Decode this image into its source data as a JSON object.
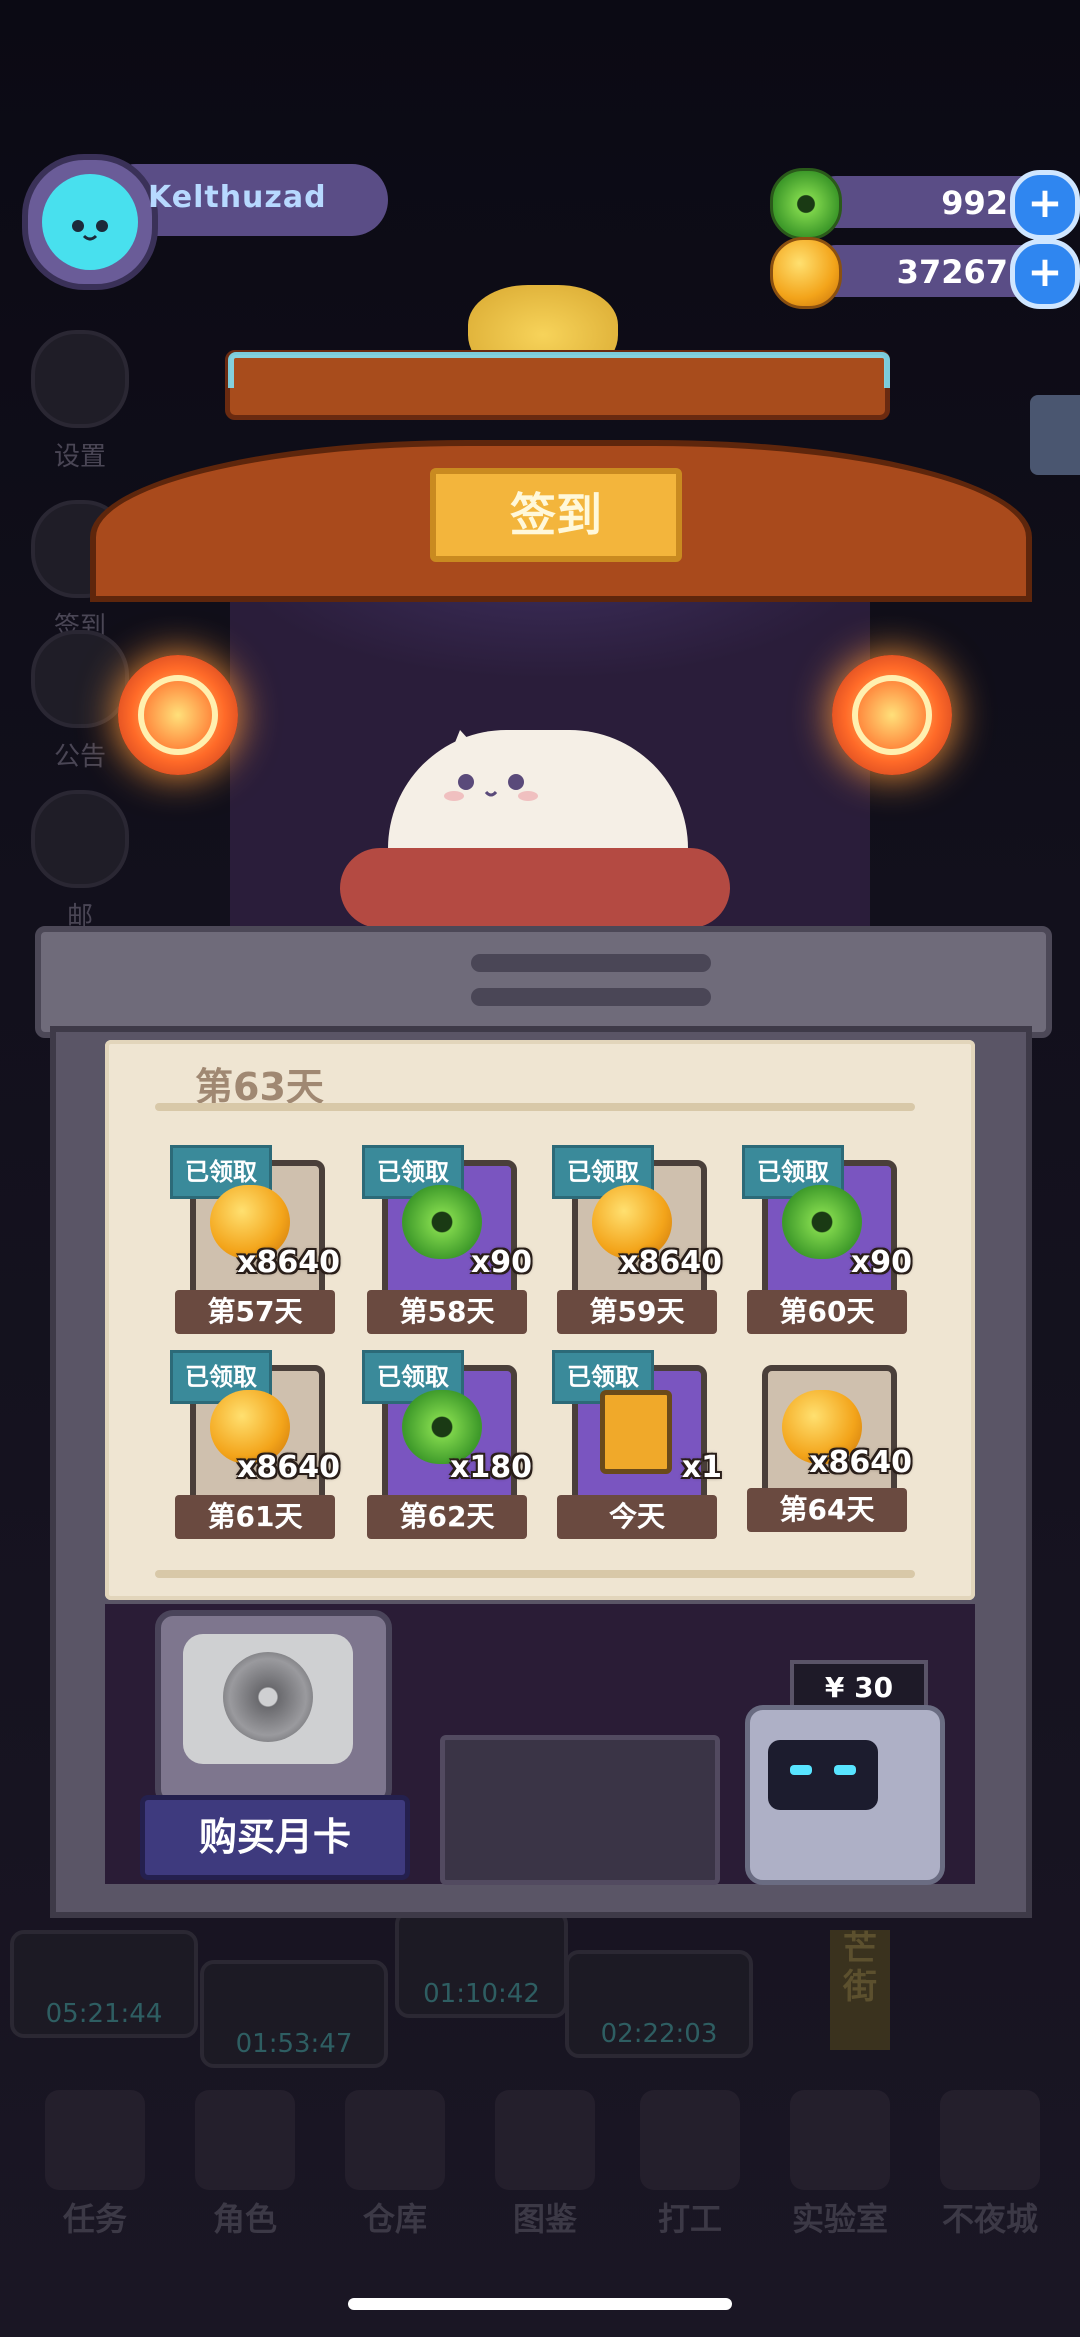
{
  "player": {
    "name": "Kelthuzad"
  },
  "currencies": [
    {
      "icon": "jade-coin-icon",
      "value": "992"
    },
    {
      "icon": "gold-coin-icon",
      "value": "37267"
    }
  ],
  "side_menu": [
    "设置",
    "签到",
    "公告",
    "邮"
  ],
  "signin": {
    "title": "签到",
    "current_day": "第63天",
    "rewards": [
      {
        "status": "已领取",
        "item": "gold",
        "qty": "x8640",
        "day": "第57天"
      },
      {
        "status": "已领取",
        "item": "jade",
        "qty": "x90",
        "day": "第58天"
      },
      {
        "status": "已领取",
        "item": "gold",
        "qty": "x8640",
        "day": "第59天"
      },
      {
        "status": "已领取",
        "item": "jade",
        "qty": "x90",
        "day": "第60天"
      },
      {
        "status": "已领取",
        "item": "gold",
        "qty": "x8640",
        "day": "第61天"
      },
      {
        "status": "已领取",
        "item": "jade",
        "qty": "x180",
        "day": "第62天"
      },
      {
        "status": "已领取",
        "item": "battery",
        "qty": "x1",
        "day": "今天"
      },
      {
        "status": "",
        "item": "gold",
        "qty": "x8640",
        "day": "第64天"
      }
    ]
  },
  "shop": {
    "buy_label": "购买月卡",
    "price": "¥ 30"
  },
  "background_timers": [
    "05:21:44",
    "01:53:47",
    "01:10:42",
    "02:22:03"
  ],
  "bottom_nav": [
    "任务",
    "角色",
    "仓库",
    "图鉴",
    "打工",
    "实验室",
    "不夜城"
  ],
  "side_sign_right": "芒街"
}
